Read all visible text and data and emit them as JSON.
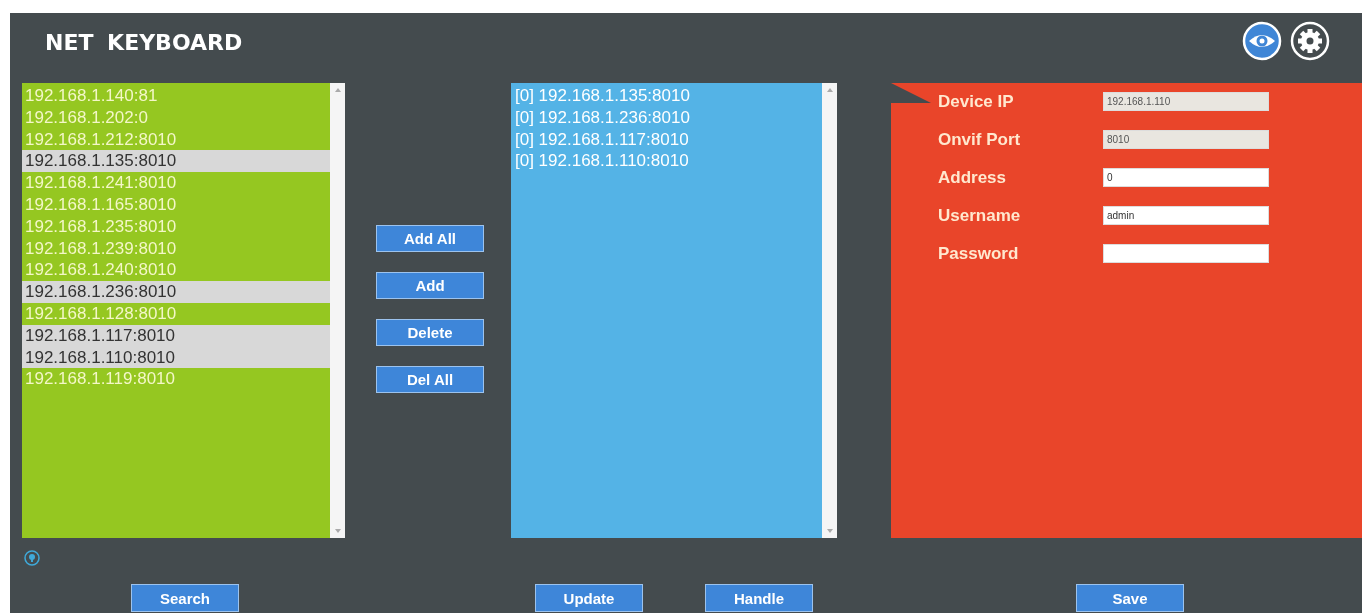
{
  "window": {
    "title": "NET KEYBOARD"
  },
  "device_list": {
    "items": [
      {
        "label": "192.168.1.140:81",
        "selected": false
      },
      {
        "label": "192.168.1.202:0",
        "selected": false
      },
      {
        "label": "192.168.1.212:8010",
        "selected": false
      },
      {
        "label": "192.168.1.135:8010",
        "selected": true
      },
      {
        "label": "192.168.1.241:8010",
        "selected": false
      },
      {
        "label": "192.168.1.165:8010",
        "selected": false
      },
      {
        "label": "192.168.1.235:8010",
        "selected": false
      },
      {
        "label": "192.168.1.239:8010",
        "selected": false
      },
      {
        "label": "192.168.1.240:8010",
        "selected": false
      },
      {
        "label": "192.168.1.236:8010",
        "selected": true
      },
      {
        "label": "192.168.1.128:8010",
        "selected": false
      },
      {
        "label": "192.168.1.117:8010",
        "selected": true
      },
      {
        "label": "192.168.1.110:8010",
        "selected": true
      },
      {
        "label": "192.168.1.119:8010",
        "selected": false
      }
    ]
  },
  "transfer_buttons": [
    "Add All",
    "Add",
    "Delete",
    "Del All"
  ],
  "added_list": {
    "items": [
      "[0] 192.168.1.135:8010",
      "[0] 192.168.1.236:8010",
      "[0] 192.168.1.117:8010",
      "[0] 192.168.1.110:8010"
    ]
  },
  "form": {
    "fields": [
      {
        "label": "Device IP",
        "value": "192.168.1.110",
        "disabled": true
      },
      {
        "label": "Onvif Port",
        "value": "8010",
        "disabled": true
      },
      {
        "label": "Address",
        "value": "0",
        "disabled": false
      },
      {
        "label": "Username",
        "value": "admin",
        "disabled": false
      },
      {
        "label": "Password",
        "disabled": false
      }
    ]
  },
  "bottom_buttons": {
    "search": "Search",
    "update": "Update",
    "handle": "Handle",
    "save": "Save"
  }
}
